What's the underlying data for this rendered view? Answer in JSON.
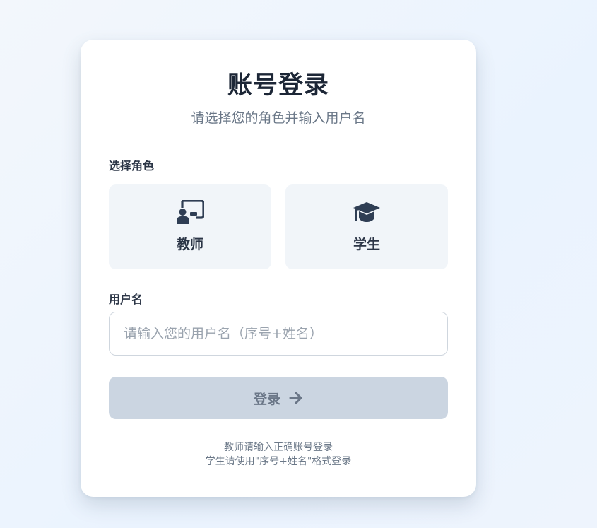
{
  "login": {
    "title": "账号登录",
    "subtitle": "请选择您的角色并输入用户名",
    "role_section_label": "选择角色",
    "roles": [
      {
        "name": "教师",
        "icon": "teacher-presentation-icon"
      },
      {
        "name": "学生",
        "icon": "graduation-cap-icon"
      }
    ],
    "username_label": "用户名",
    "username_placeholder": "请输入您的用户名（序号+姓名）",
    "username_value": "",
    "login_button_label": "登录",
    "login_button_icon": "arrow-right-icon",
    "login_button_disabled": true,
    "hints": [
      "教师请输入正确账号登录",
      "学生请使用\"序号+姓名\"格式登录"
    ]
  },
  "colors": {
    "background": "#eef4fd",
    "card": "#ffffff",
    "title": "#1c2636",
    "muted_text": "#6b7888",
    "role_card_bg": "#f1f5f9",
    "icon": "#2f3e54",
    "button_disabled_bg": "#cbd5e1",
    "button_disabled_text": "#6b7788"
  }
}
